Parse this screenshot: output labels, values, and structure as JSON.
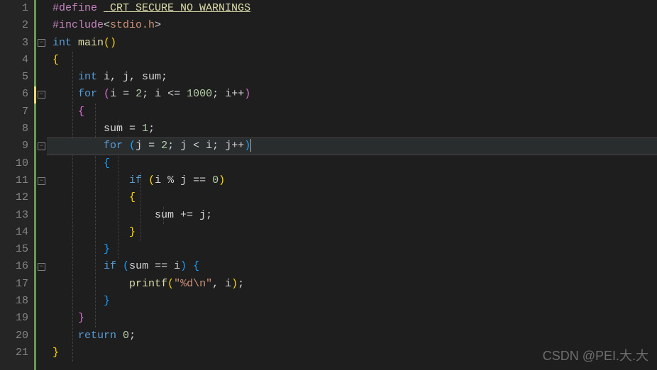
{
  "watermark": "CSDN @PEI.大.大",
  "line_numbers": [
    "1",
    "2",
    "3",
    "4",
    "5",
    "6",
    "7",
    "8",
    "9",
    "10",
    "11",
    "12",
    "13",
    "14",
    "15",
    "16",
    "17",
    "18",
    "19",
    "20",
    "21"
  ],
  "fold_marks": {
    "3": true,
    "6": true,
    "9": true,
    "11": true,
    "16": true
  },
  "modified_lines": [
    6
  ],
  "current_line": 9,
  "code": {
    "l1_define": "#define",
    "l1_macro": "_CRT_SECURE_NO_WARNINGS",
    "l2_include": "#include",
    "l2_header": "stdio.h",
    "l3_int": "int",
    "l3_main": "main",
    "l5_int": "int",
    "l5_vars": "i, j, sum;",
    "l6_for": "for",
    "l6_i": "i",
    "l6_eq": " = ",
    "l6_2": "2",
    "l6_semi1": "; ",
    "l6_i2": "i",
    "l6_le": " <= ",
    "l6_1000": "1000",
    "l6_semi2": "; ",
    "l6_inc": "i++",
    "l8_sum": "sum",
    "l8_eq": " = ",
    "l8_1": "1",
    "l9_for": "for",
    "l9_j": "j",
    "l9_eq": " = ",
    "l9_2": "2",
    "l9_semi1": "; ",
    "l9_j2": "j",
    "l9_lt": " < ",
    "l9_i": "i",
    "l9_semi2": "; ",
    "l9_inc": "j++",
    "l11_if": "if",
    "l11_i": "i",
    "l11_mod": " % ",
    "l11_j": "j",
    "l11_eqeq": " == ",
    "l11_0": "0",
    "l13_sum": "sum",
    "l13_pluseq": " += ",
    "l13_j": "j",
    "l16_if": "if",
    "l16_sum": "sum",
    "l16_eqeq": " == ",
    "l16_i": "i",
    "l17_printf": "printf",
    "l17_fmt": "\"%d\\n\"",
    "l17_i": "i",
    "l20_return": "return",
    "l20_0": "0"
  }
}
